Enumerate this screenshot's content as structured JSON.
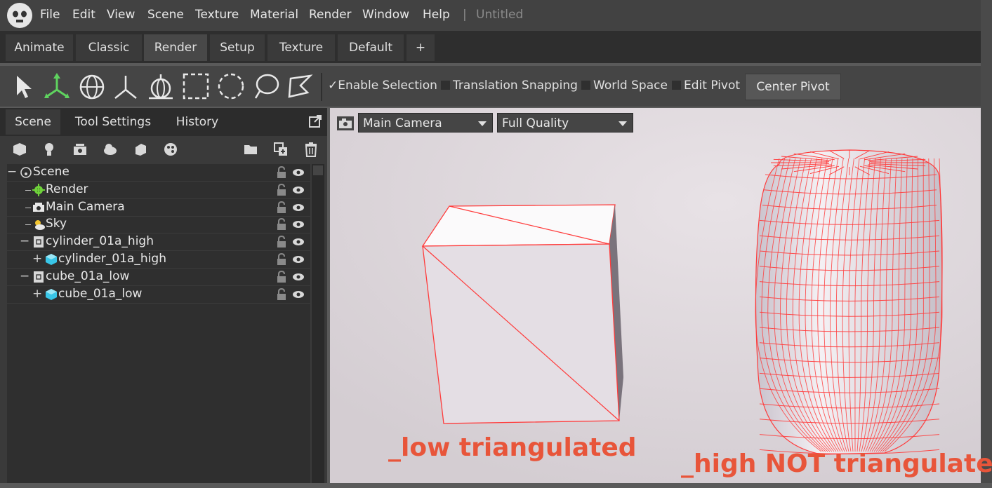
{
  "app": {
    "menu": [
      "File",
      "Edit",
      "View",
      "Scene",
      "Texture",
      "Material",
      "Render",
      "Window",
      "Help"
    ],
    "separator": "|",
    "document_title": "Untitled"
  },
  "workspace_tabs": [
    {
      "label": "Animate",
      "active": false
    },
    {
      "label": "Classic",
      "active": false
    },
    {
      "label": "Render",
      "active": true
    },
    {
      "label": "Setup",
      "active": false
    },
    {
      "label": "Texture",
      "active": false
    },
    {
      "label": "Default",
      "active": false
    },
    {
      "label": "+",
      "active": false
    }
  ],
  "toolbar": {
    "tools": [
      "select-tool-icon",
      "move-tool-icon",
      "rotate-tool-icon",
      "scale-tool-icon",
      "pivot-tool-icon",
      "rect-select-icon",
      "ellipse-select-icon",
      "lasso-select-icon",
      "polygon-select-icon"
    ],
    "enable_selection": {
      "label": "Enable Selection",
      "checked": true,
      "mark": "✓"
    },
    "translation_snapping": {
      "label": "Translation Snapping",
      "checked": false
    },
    "world_space": {
      "label": "World Space",
      "checked": false
    },
    "edit_pivot": {
      "label": "Edit Pivot",
      "checked": false
    },
    "center_pivot": "Center Pivot"
  },
  "left_panel": {
    "tabs": [
      "Scene",
      "Tool Settings",
      "History"
    ],
    "active_tab": "Scene",
    "add_icons": [
      "add-mesh-icon",
      "add-light-icon",
      "add-camera-icon",
      "add-sky-icon",
      "add-shape-icon",
      "add-material-icon"
    ],
    "action_icons": [
      "folder-icon",
      "group-icon",
      "trash-icon"
    ],
    "tree": [
      {
        "label": "Scene",
        "expander": "−",
        "icon": "scene-icon"
      },
      {
        "label": "Render",
        "icon": "render-gear-icon"
      },
      {
        "label": "Main Camera",
        "icon": "camera-icon"
      },
      {
        "label": "Sky",
        "icon": "sky-icon"
      },
      {
        "label": "cylinder_01a_high",
        "expander": "−",
        "icon": "group-node-icon"
      },
      {
        "label": "cylinder_01a_high",
        "expander": "+",
        "icon": "mesh-icon"
      },
      {
        "label": "cube_01a_low",
        "expander": "−",
        "icon": "group-node-icon"
      },
      {
        "label": "cube_01a_low",
        "expander": "+",
        "icon": "mesh-icon"
      }
    ]
  },
  "viewport": {
    "camera_select": "Main Camera",
    "quality_select": "Full Quality",
    "annotations": {
      "low": "_low triangulated",
      "high": "_high NOT triangulated"
    },
    "colors": {
      "background": "#dcd6da",
      "wireframe": "#ff3b3b",
      "annotation": "#e8553a"
    }
  }
}
